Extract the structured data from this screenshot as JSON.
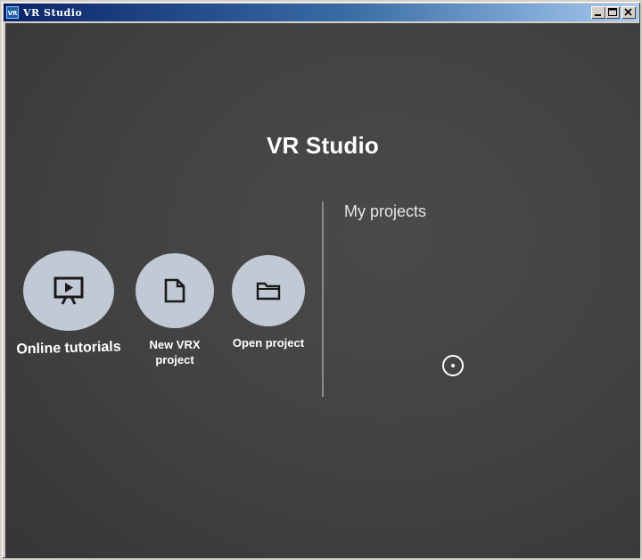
{
  "window": {
    "title": "VR Studio",
    "icon_text": "VR"
  },
  "main": {
    "title": "VR Studio",
    "actions": [
      {
        "label": "Online tutorials",
        "icon": "presentation-play-icon"
      },
      {
        "label": "New VRX project",
        "icon": "new-file-icon"
      },
      {
        "label": "Open project",
        "icon": "folder-icon"
      }
    ],
    "projects_heading": "My projects"
  },
  "colors": {
    "background": "#414141",
    "button_circle": "#c0c9d4",
    "text": "#ffffff",
    "titlebar_start": "#0a246a"
  }
}
